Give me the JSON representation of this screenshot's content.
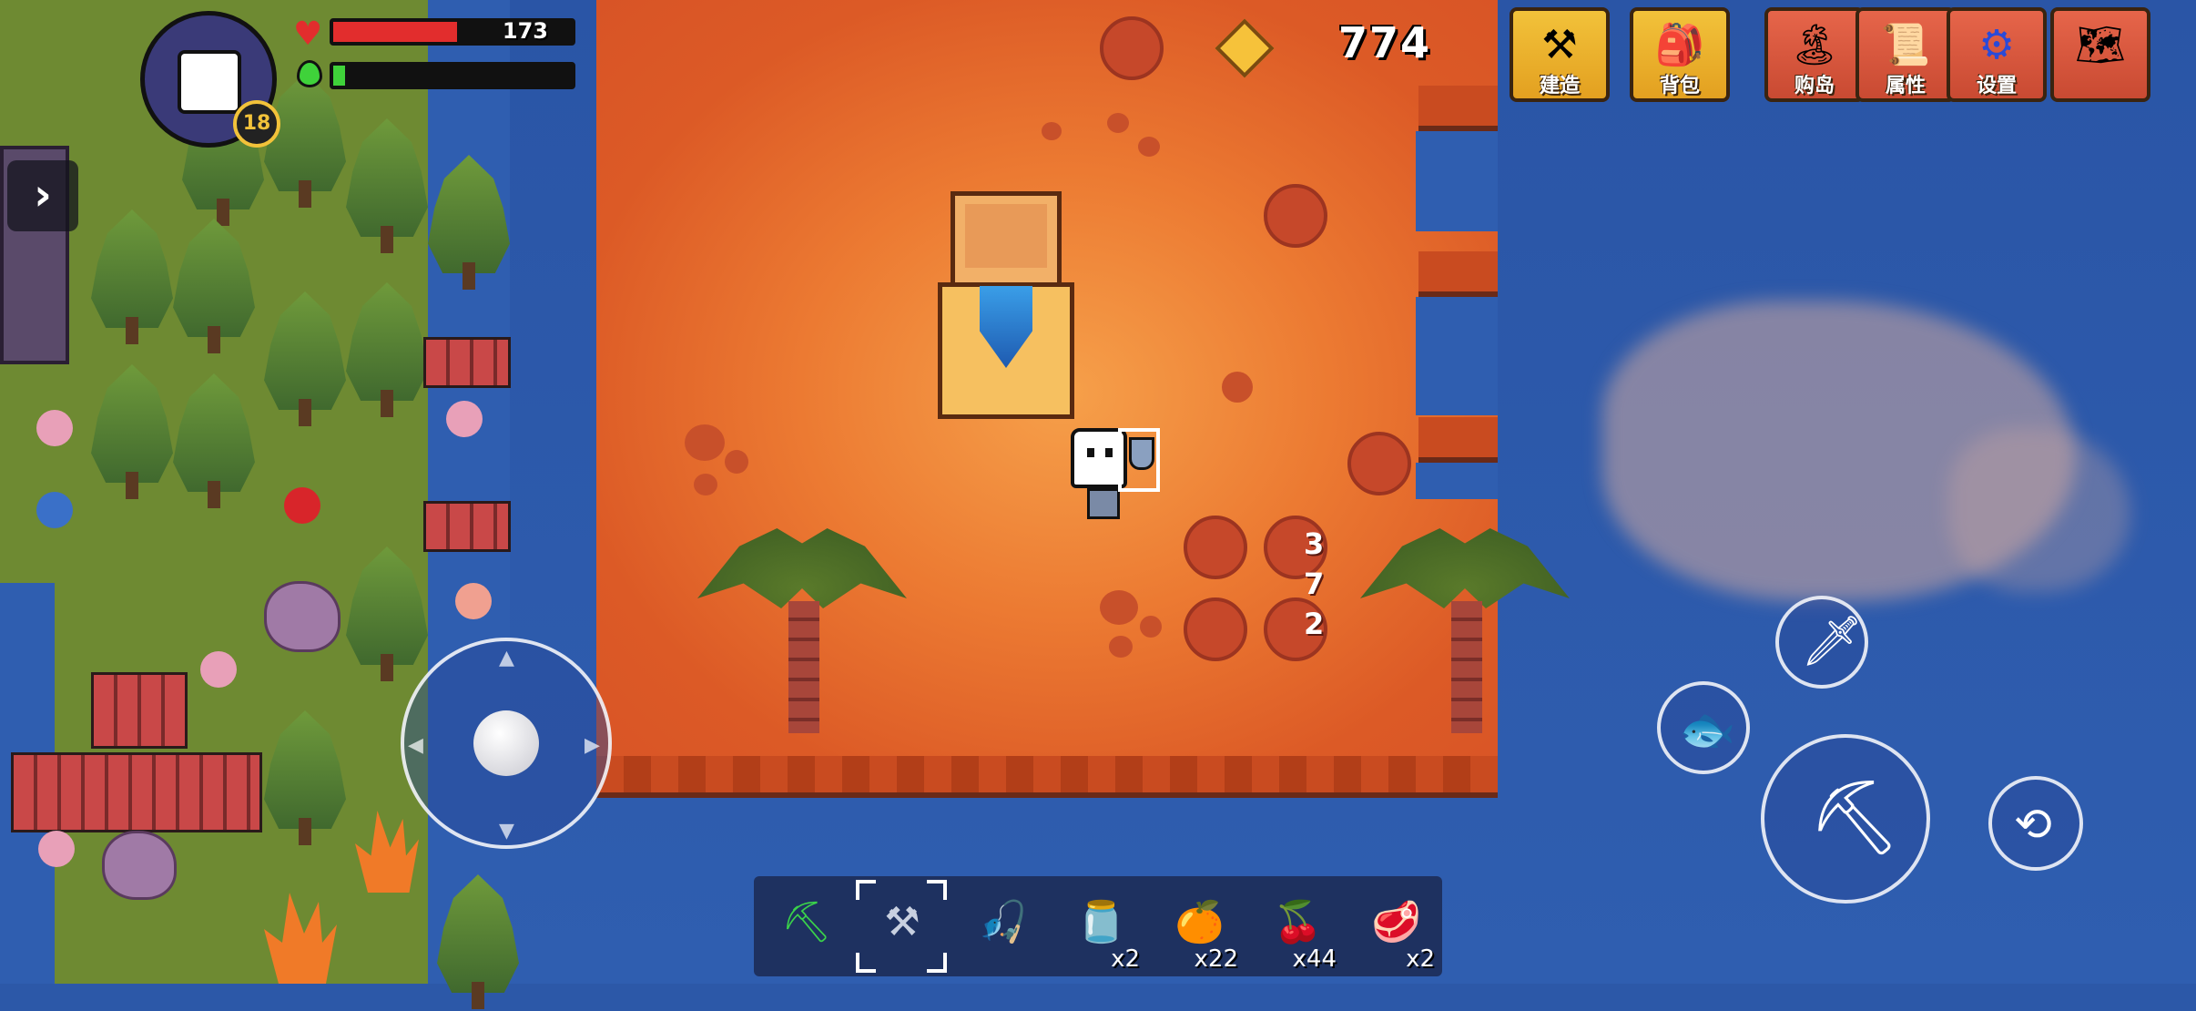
{
  "player": {
    "level": "18",
    "health_text": "173",
    "health_fraction": 0.52,
    "energy_fraction": 0.05
  },
  "currency": {
    "gem_count": "774",
    "gem_icon": "diamond-icon"
  },
  "menu": {
    "build_label": "建造",
    "backpack_label": "背包",
    "buy_island_label": "购岛",
    "attributes_label": "属性",
    "settings_label": "设置"
  },
  "hotbar": {
    "items": [
      {
        "name": "pickaxe",
        "count": ""
      },
      {
        "name": "shovel",
        "count": "",
        "selected": true
      },
      {
        "name": "fishing-rod",
        "count": ""
      },
      {
        "name": "bottle",
        "count": "x2"
      },
      {
        "name": "orange",
        "count": "x22"
      },
      {
        "name": "berries",
        "count": "x44"
      },
      {
        "name": "meat",
        "count": "x2"
      }
    ]
  },
  "world_labels": {
    "dig_marks": [
      "3",
      "7",
      "2"
    ]
  },
  "colors": {
    "accent_gold": "#f2c23a",
    "health_red": "#e22d2d",
    "energy_green": "#3fd23a",
    "water_blue": "#2f5eb0",
    "sand_orange": "#ec7a32"
  }
}
